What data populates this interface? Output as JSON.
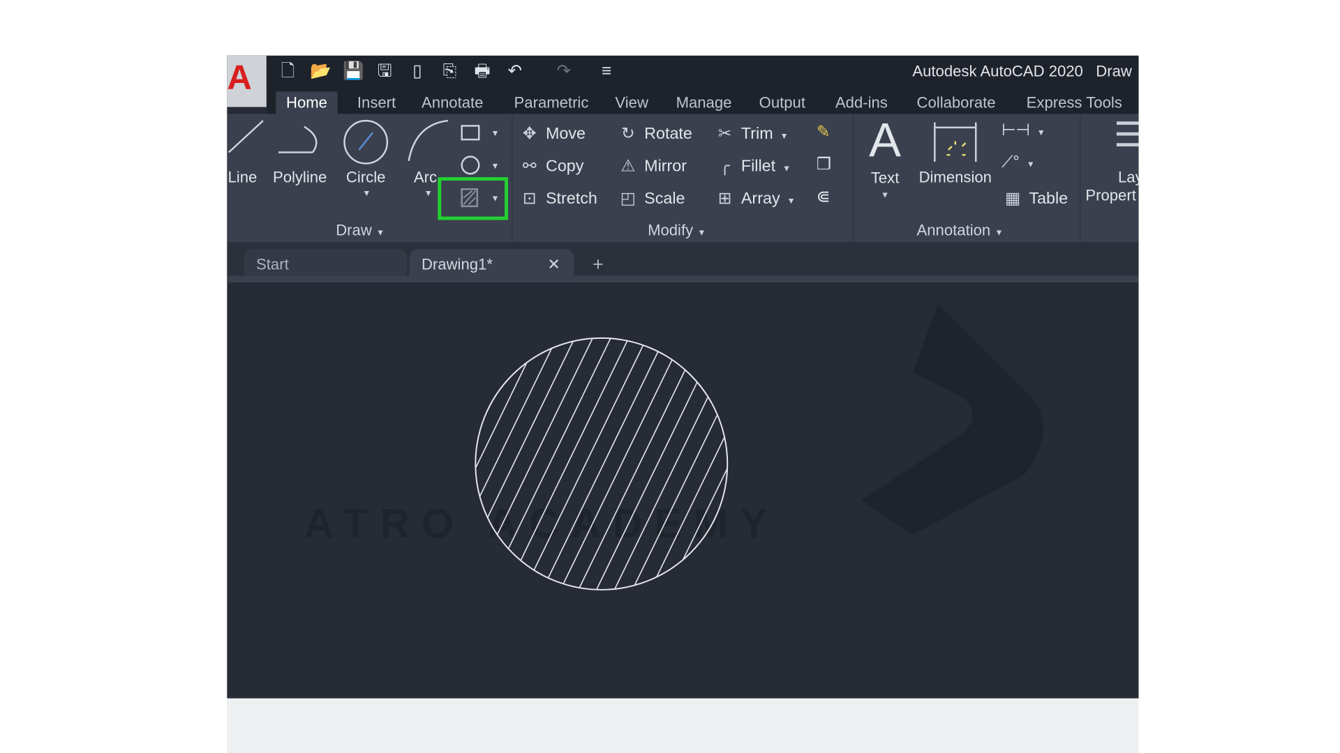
{
  "app": {
    "title": "Autodesk AutoCAD 2020",
    "title_suffix": "Draw",
    "logo_letter": "A"
  },
  "quick_access": [
    {
      "icon": "new-file-icon",
      "glyph": "🗋"
    },
    {
      "icon": "open-folder-icon",
      "glyph": "📂"
    },
    {
      "icon": "save-icon",
      "glyph": "💾"
    },
    {
      "icon": "save-as-icon",
      "glyph": "🖫"
    },
    {
      "icon": "open-web-icon",
      "glyph": "▯"
    },
    {
      "icon": "share-icon",
      "glyph": "⎘"
    },
    {
      "icon": "print-icon",
      "glyph": "🖶"
    },
    {
      "icon": "undo-icon",
      "glyph": "↶"
    },
    {
      "icon": "redo-icon",
      "glyph": "↷"
    },
    {
      "icon": "customize-icon",
      "glyph": "≡"
    }
  ],
  "ribbon_tabs": [
    "Home",
    "Insert",
    "Annotate",
    "Parametric",
    "View",
    "Manage",
    "Output",
    "Add-ins",
    "Collaborate",
    "Express Tools"
  ],
  "active_tab": "Home",
  "draw": {
    "label": "Draw",
    "line": "Line",
    "polyline": "Polyline",
    "circle": "Circle",
    "arc": "Arc"
  },
  "modify": {
    "label": "Modify",
    "move": "Move",
    "copy": "Copy",
    "stretch": "Stretch",
    "rotate": "Rotate",
    "mirror": "Mirror",
    "scale": "Scale",
    "trim": "Trim",
    "fillet": "Fillet",
    "array": "Array"
  },
  "annotation": {
    "label": "Annotation",
    "text": "Text",
    "dimension": "Dimension",
    "table": "Table"
  },
  "layers": {
    "label_1": "Layer",
    "label_2": "Propert"
  },
  "doc_tabs": {
    "start": "Start",
    "drawing": "Drawing1*",
    "close": "✕",
    "new": "+"
  },
  "watermark": "ATRO ACADEMY",
  "colors": {
    "highlight": "#22d130",
    "logo": "#d81e1e"
  }
}
